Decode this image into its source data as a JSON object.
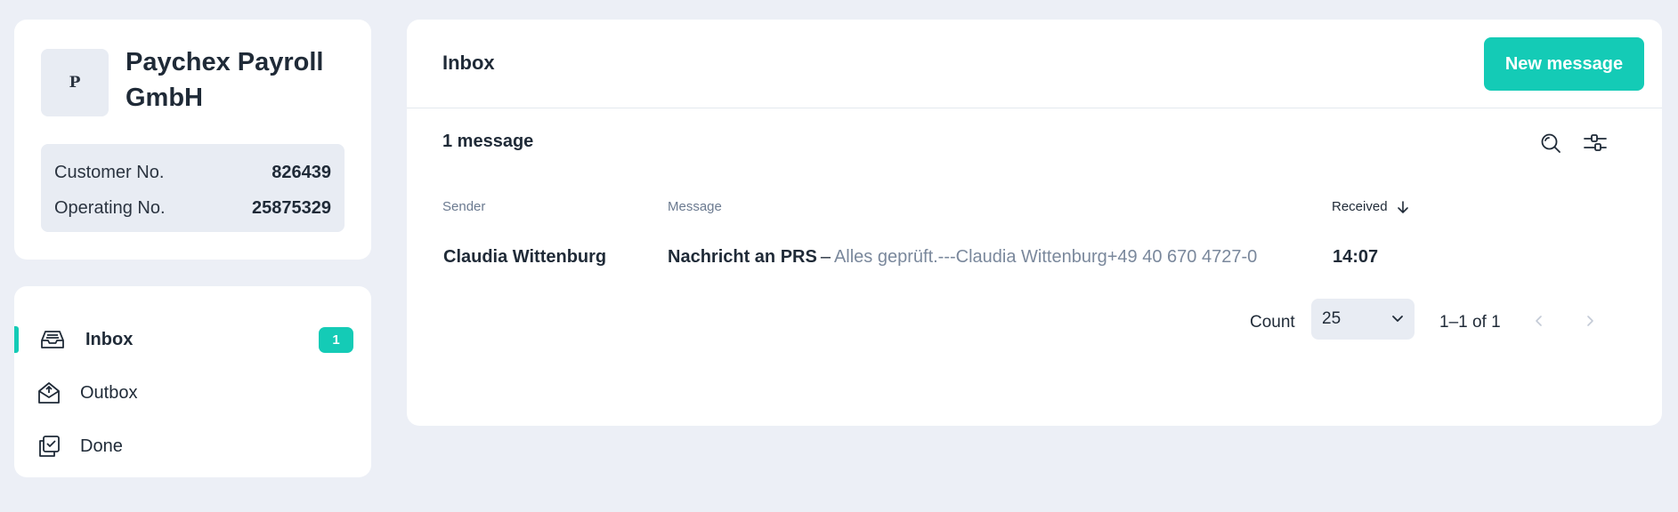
{
  "company": {
    "avatar_letter": "P",
    "name": "Paychex Payroll GmbH",
    "customer_label": "Customer No.",
    "customer_value": "826439",
    "operating_label": "Operating No.",
    "operating_value": "25875329"
  },
  "nav": {
    "inbox": {
      "label": "Inbox",
      "icon": "inbox-icon",
      "badge": "1"
    },
    "outbox": {
      "label": "Outbox",
      "icon": "outbox-icon"
    },
    "done": {
      "label": "Done",
      "icon": "done-icon"
    }
  },
  "main": {
    "title": "Inbox",
    "new_message_label": "New message",
    "message_count": "1 message",
    "columns": {
      "sender": "Sender",
      "message": "Message",
      "received": "Received"
    },
    "rows": [
      {
        "sender": "Claudia Wittenburg",
        "subject": "Nachricht an PRS",
        "dash": "–",
        "preview": "Alles geprüft.---Claudia Wittenburg+49 40 670 4727-0",
        "received": "14:07"
      }
    ],
    "pagination": {
      "count_label": "Count",
      "count_value": "25",
      "range": "1–1 of 1"
    }
  },
  "colors": {
    "accent": "#14cbb6",
    "background": "#eceff6",
    "text": "#1f2a37",
    "muted": "#7a889c"
  }
}
